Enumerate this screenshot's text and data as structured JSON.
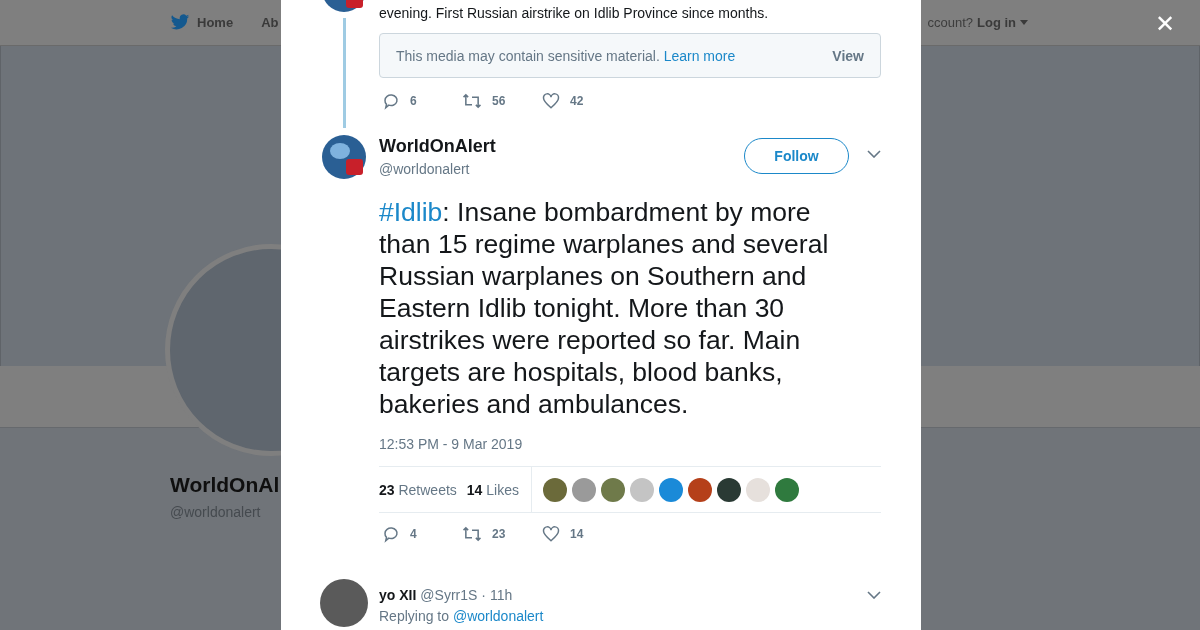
{
  "backdrop": {
    "nav": {
      "home": "Home",
      "about_partial": "Ab",
      "account_prompt": "ccount?",
      "login": "Log in"
    },
    "profile": {
      "name": "WorldOnAl",
      "handle": "@worldonalert"
    }
  },
  "close_label": "✕",
  "previous_tweet": {
    "text": "evening. First Russian airstrike on Idlib Province since months.",
    "media_notice": {
      "message": "This media may contain sensitive material.",
      "link": "Learn more",
      "action": "View"
    },
    "actions": {
      "replies": "6",
      "retweets": "56",
      "likes": "42"
    }
  },
  "tweet": {
    "name": "WorldOnAlert",
    "handle": "@worldonalert",
    "follow": "Follow",
    "hashtag": "#Idlib",
    "text": ": Insane bombardment by more than 15 regime warplanes and several Russian warplanes on Southern and Eastern Idlib tonight. More than 30 airstrikes were reported so far. Main targets are hospitals, blood banks, bakeries and ambulances.",
    "timestamp": "12:53 PM - 9 Mar 2019",
    "retweet_count": "23",
    "retweet_label": "Retweets",
    "like_count": "14",
    "like_label": "Likes",
    "likers": [
      {
        "color": "#6b6a3a"
      },
      {
        "color": "#9a9a9a"
      },
      {
        "color": "#6f7a4a"
      },
      {
        "color": "#c4c4c4"
      },
      {
        "color": "#1a8ad8"
      },
      {
        "color": "#b5401a"
      },
      {
        "color": "#2a3a34"
      },
      {
        "color": "#e6e0dc"
      },
      {
        "color": "#2f7a3e"
      }
    ],
    "actions": {
      "replies": "4",
      "retweets": "23",
      "likes": "14"
    }
  },
  "reply": {
    "name": "yo XII",
    "handle": "@Syrr1S",
    "separator": "·",
    "time": "11h",
    "replying_label": "Replying to",
    "replying_to": "@worldonalert"
  }
}
